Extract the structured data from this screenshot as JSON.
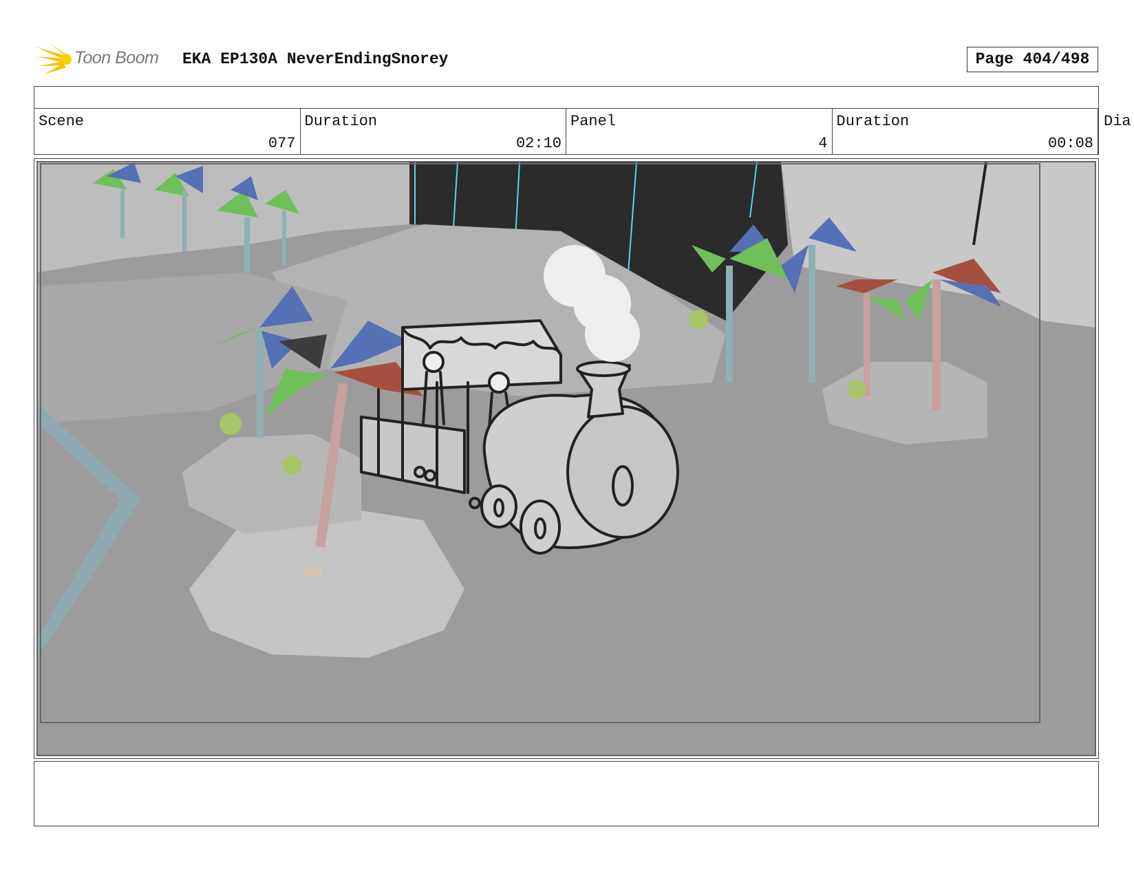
{
  "header": {
    "logo_text": "Toon Boom",
    "title": "EKA EP130A NeverEndingSnorey",
    "page": "Page 404/498"
  },
  "meta": [
    {
      "label": "Scene",
      "value": "077"
    },
    {
      "label": "Duration",
      "value": "02:10"
    },
    {
      "label": "Panel",
      "value": "4"
    },
    {
      "label": "Duration",
      "value": "00:08"
    }
  ],
  "overflow_label": "Dia",
  "panel": {
    "description_icon": "storyboard-train-scene"
  },
  "colors": {
    "logo_yellow": "#f5c400",
    "ground": "#9a9a9a",
    "palm_green": "#6fbf5a",
    "palm_blue": "#5570b5",
    "palm_red": "#a5503f",
    "sky_dark": "#2a2a2a",
    "accent_cyan": "#5fd0ee"
  }
}
